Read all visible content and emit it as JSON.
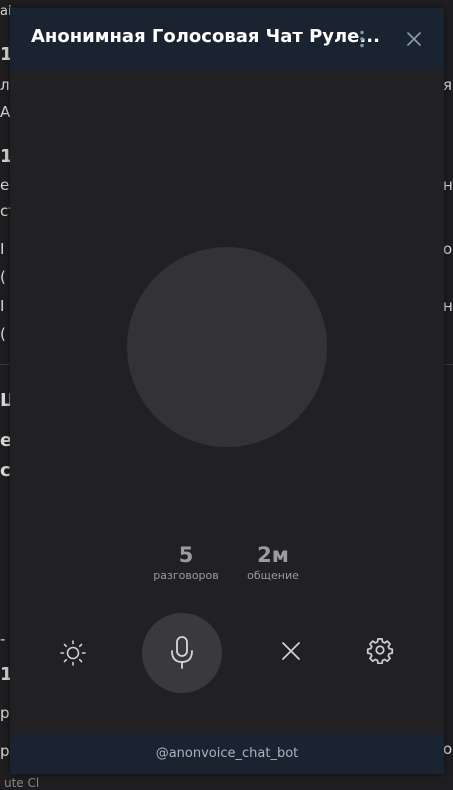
{
  "window": {
    "title": "Анонимная Голосовая Чат Руле...",
    "more_icon": "more-vertical-icon",
    "close_icon": "close-icon"
  },
  "stats": {
    "conversations": {
      "value": "5",
      "label": "разговоров"
    },
    "time": {
      "value": "2м",
      "label": "общение"
    }
  },
  "controls": {
    "theme_icon": "sun-icon",
    "mic_icon": "microphone-icon",
    "skip_icon": "close-icon",
    "settings_icon": "gear-icon"
  },
  "footer": {
    "handle": "@anonvoice_chat_bot"
  },
  "background_fragments": [
    "ai",
    "1. I",
    "л",
    "я",
    "A",
    "1. .",
    "е",
    "но",
    "ст",
    "I",
    "о",
    "(",
    "I",
    "нз",
    "(",
    "Ш",
    "е",
    "с",
    "p",
    "-",
    "1.",
    "р",
    "o",
    "ute Cl"
  ],
  "colors": {
    "header_bg": "#1a2430",
    "panel_bg": "#212123",
    "mic_bg": "#3a3a3c",
    "avatar_bg": "#333335"
  }
}
